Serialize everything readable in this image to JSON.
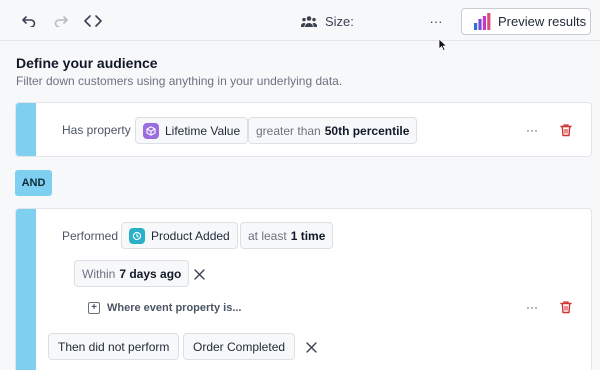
{
  "toolbar": {
    "size_label": "Size:",
    "more_label": "···",
    "preview_label": "Preview results"
  },
  "header": {
    "title": "Define your audience",
    "subtitle": "Filter down customers using anything in your underlying data."
  },
  "condition1": {
    "prefix": "Has property",
    "property": "Lifetime Value",
    "operator": "greater than",
    "value": "50th percentile",
    "more_label": "···"
  },
  "connector": {
    "label": "AND"
  },
  "condition2": {
    "prefix": "Performed",
    "event": "Product Added",
    "frequency_prefix": "at least",
    "frequency_value": "1 time",
    "window_prefix": "Within",
    "window_value": "7 days ago",
    "where_label": "Where event property is...",
    "more_label": "···",
    "not_perform_label": "Then did not perform",
    "not_perform_event": "Order Completed"
  },
  "colors": {
    "accent_bar": "#7fd0f0",
    "property_icon": "#9b6dde",
    "event_icon": "#2ab0c8",
    "trash": "#d0312d",
    "chart_bars": [
      "#2f6fd6",
      "#7b4ad8",
      "#c03bc0",
      "#e04a7a"
    ]
  }
}
